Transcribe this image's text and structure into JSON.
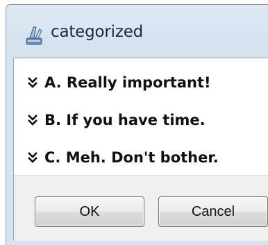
{
  "window": {
    "title": "categorized",
    "icon": "app-icon"
  },
  "options": [
    {
      "label": "A. Really important!",
      "icon": "double-chevron-down-icon"
    },
    {
      "label": "B. If you have time.",
      "icon": "double-chevron-down-icon"
    },
    {
      "label": "C. Meh. Don't bother.",
      "icon": "double-chevron-down-icon"
    }
  ],
  "buttons": {
    "ok_label": "OK",
    "cancel_label": "Cancel"
  },
  "colors": {
    "frame": "#dfe9f4",
    "client": "#f0f0f0",
    "list_background": "#ffffff"
  }
}
